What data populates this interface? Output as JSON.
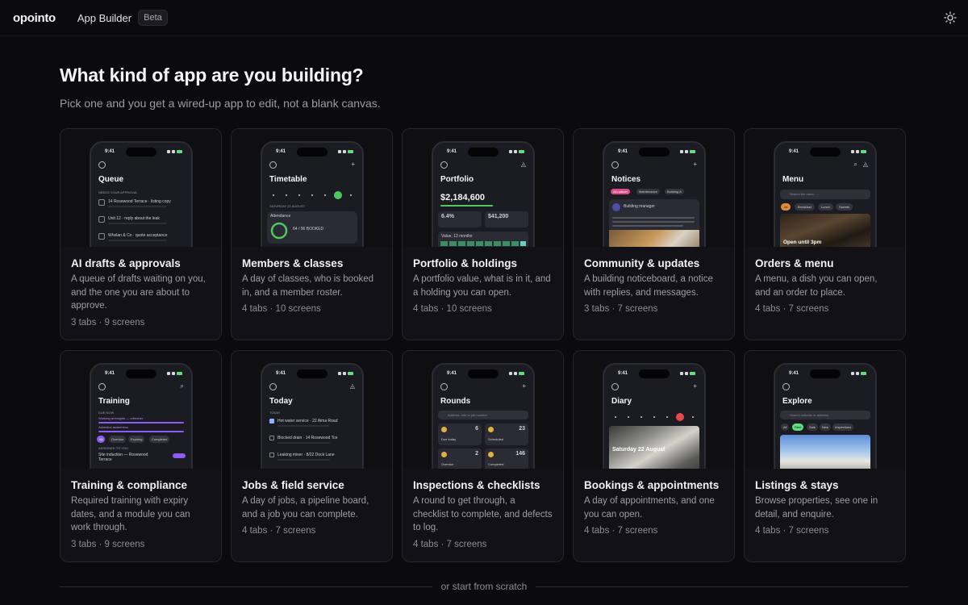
{
  "header": {
    "logo": "opointo",
    "app_name": "App Builder",
    "badge": "Beta",
    "theme_toggle_icon": "sun-icon"
  },
  "page": {
    "title": "What kind of app are you building?",
    "subtitle": "Pick one and you get a wired-up app to edit, not a blank canvas.",
    "footer_option": "or start from scratch"
  },
  "templates": [
    {
      "title": "AI drafts & approvals",
      "description": "A queue of drafts waiting on you, and the one you are about to approve.",
      "meta": "3 tabs · 9 screens",
      "preview": {
        "screen": "Queue",
        "time": "9:41",
        "lines": [
          "NEEDS YOUR APPROVAL",
          "14 Rosewood Terrace · listing copy",
          "Unit 12 · reply about the leak",
          "Whelan & Co · quote acceptance"
        ]
      }
    },
    {
      "title": "Members & classes",
      "description": "A day of classes, who is booked in, and a member roster.",
      "meta": "4 tabs · 10 screens",
      "preview": {
        "screen": "Timetable",
        "time": "9:41",
        "lines": [
          "SATURDAY 22 AUGUST",
          "Attendance",
          "64 / 96 BOOKED"
        ]
      }
    },
    {
      "title": "Portfolio & holdings",
      "description": "A portfolio value, what is in it, and a holding you can open.",
      "meta": "4 tabs · 10 screens",
      "preview": {
        "screen": "Portfolio",
        "time": "9:41",
        "lines": [
          "$2,184,600",
          "6.4%",
          "$41,200",
          "Value, 12 months"
        ]
      }
    },
    {
      "title": "Community & updates",
      "description": "A building noticeboard, a notice with replies, and messages.",
      "meta": "3 tabs · 7 screens",
      "preview": {
        "screen": "Notices",
        "time": "9:41",
        "lines": [
          "All notices",
          "Maintenance",
          "Building A",
          "Building manager"
        ]
      }
    },
    {
      "title": "Orders & menu",
      "description": "A menu, a dish you can open, and an order to place.",
      "meta": "4 tabs · 7 screens",
      "preview": {
        "screen": "Menu",
        "time": "9:41",
        "lines": [
          "Search the menu",
          "All",
          "Breakfast",
          "Lunch",
          "Sweets",
          "Open until 3pm"
        ]
      }
    },
    {
      "title": "Training & compliance",
      "description": "Required training with expiry dates, and a module you can work through.",
      "meta": "3 tabs · 9 screens",
      "preview": {
        "screen": "Training",
        "time": "9:41",
        "lines": [
          "DUE NOW",
          "Working at heights — refresher",
          "Asbestos awareness",
          "All",
          "Overdue",
          "Expiring",
          "Completed",
          "ASSIGNED TO YOU",
          "Site induction — Rosewood Terrace"
        ]
      }
    },
    {
      "title": "Jobs & field service",
      "description": "A day of jobs, a pipeline board, and a job you can complete.",
      "meta": "4 tabs · 7 screens",
      "preview": {
        "screen": "Today",
        "time": "9:41",
        "lines": [
          "TODAY",
          "Hot water service · 22 Alma Road",
          "Blocked drain · 14 Rosewood Tce",
          "Leaking mixer · 8/22 Dock Lane"
        ]
      }
    },
    {
      "title": "Inspections & checklists",
      "description": "A round to get through, a checklist to complete, and defects to log.",
      "meta": "4 tabs · 7 screens",
      "preview": {
        "screen": "Rounds",
        "time": "9:41",
        "lines": [
          "Address, site or job number",
          "Due today",
          "Scheduled",
          "Overdue",
          "Completed"
        ],
        "stats": [
          "6",
          "23",
          "2",
          "146"
        ]
      }
    },
    {
      "title": "Bookings & appointments",
      "description": "A day of appointments, and one you can open.",
      "meta": "4 tabs · 7 screens",
      "preview": {
        "screen": "Diary",
        "time": "9:41",
        "lines": [
          "Saturday 22 August"
        ]
      }
    },
    {
      "title": "Listings & stays",
      "description": "Browse properties, see one in detail, and enquire.",
      "meta": "4 tabs · 7 screens",
      "preview": {
        "screen": "Explore",
        "time": "9:41",
        "lines": [
          "Search suburbs or address",
          "All",
          "Rent",
          "Sale",
          "New",
          "Inspections"
        ]
      }
    }
  ],
  "colors": {
    "background": "#0b0b0d",
    "card": "#121216",
    "accent_green": "#4ec95f",
    "accent_purple": "#8b5cf6",
    "accent_red": "#e5484d"
  }
}
